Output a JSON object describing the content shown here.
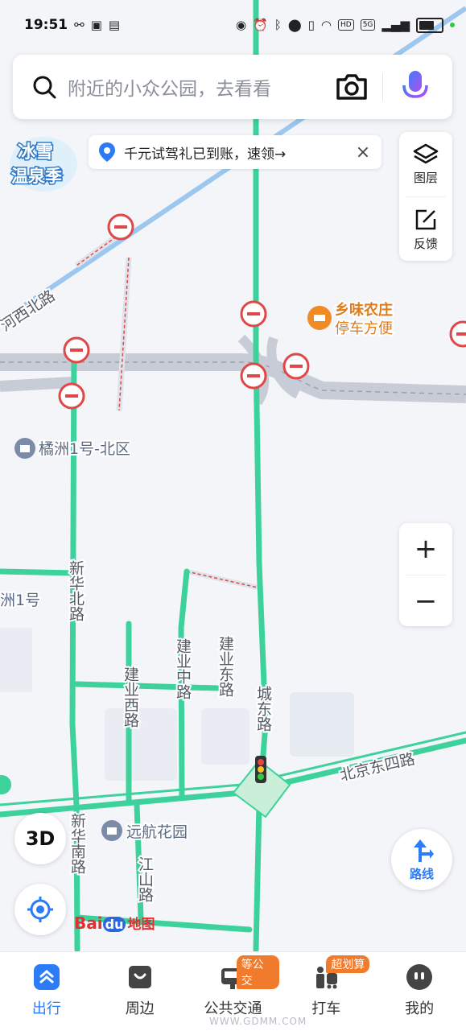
{
  "status_bar": {
    "time": "19:51",
    "network_badges": [
      "HD",
      "5G"
    ]
  },
  "search": {
    "placeholder": "附近的小众公园，去看看",
    "icons": [
      "search-icon",
      "camera-icon",
      "microphone-icon"
    ]
  },
  "promo": {
    "line1": "冰雪",
    "line2": "温泉季"
  },
  "notice": {
    "text": "千元试驾礼已到账，速领→",
    "close": "×"
  },
  "side_panel": {
    "layers_label": "图层",
    "feedback_label": "反馈"
  },
  "zoom": {
    "in": "+",
    "out": "−"
  },
  "controls": {
    "btn_3d": "3D",
    "route_label": "路线"
  },
  "map": {
    "roads": {
      "hexi": "河西北路",
      "xinhua_north": "新华北路",
      "jianye_west": "建业西路",
      "jianye_middle": "建业中路",
      "jianye_east": "建业东路",
      "chengdong": "城东路",
      "beijing_east4": "北京东四路",
      "xinhua_south": "新华南路",
      "jiangshan": "江山路"
    },
    "pois": {
      "juzhou_north": "橘洲1号-北区",
      "juzhou_partial": "洲1号",
      "yuanhang": "远航花园",
      "xiangwei_name": "乡味农庄",
      "xiangwei_sub": "停车方便"
    },
    "colors": {
      "road_green": "#3dd29b",
      "road_gray": "#c8ccd6",
      "restriction_red": "#e04747",
      "river": "#9cc8f0"
    }
  },
  "logo": {
    "bai": "Bai",
    "du": "du",
    "map": "地图"
  },
  "tabs": [
    {
      "label": "出行",
      "active": true,
      "badge": ""
    },
    {
      "label": "周边",
      "active": false,
      "badge": ""
    },
    {
      "label": "公共交通",
      "active": false,
      "badge": "等公交"
    },
    {
      "label": "打车",
      "active": false,
      "badge": "超划算"
    },
    {
      "label": "我的",
      "active": false,
      "badge": ""
    }
  ],
  "watermark": "WWW.GDMM.COM"
}
